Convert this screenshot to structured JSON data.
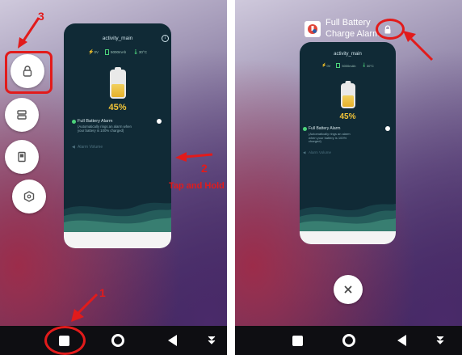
{
  "card": {
    "title": "activity_main",
    "stats": {
      "voltage": "0V",
      "capacity": "5000mAh",
      "temperature": "30°C"
    },
    "percent": "45%",
    "level": 0.45,
    "alarm_title": "Full Battery Alarm",
    "alarm_desc": "(Automatically rings an alarm when your battery is 100% charged)",
    "volume_label": "Alarm Volume"
  },
  "right": {
    "app_name_line1": "Full Battery",
    "app_name_line2": "Charge Alarm"
  },
  "annotations": {
    "step1": "1",
    "step2": "2",
    "step3": "3",
    "tap_hold": "Tap and Hold"
  },
  "icons": {
    "recents": "square-icon",
    "home": "circle-icon",
    "back": "triangle-icon",
    "lock": "lock-icon",
    "split": "split-screen-icon",
    "freeform": "window-icon",
    "settings": "hexagon-icon",
    "close": "close-icon",
    "info": "info-icon"
  },
  "colors": {
    "annotation": "#e21b1b",
    "card_bg": "#102a36",
    "percent": "#f2c438",
    "accent_green": "#4cd37b"
  }
}
